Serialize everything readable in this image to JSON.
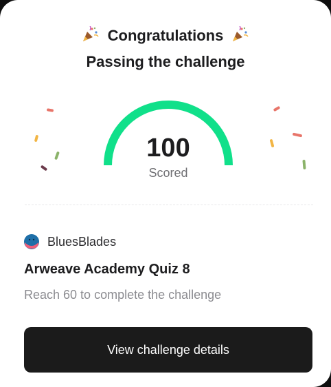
{
  "header": {
    "title": "Congratulations",
    "subtitle": "Passing the challenge",
    "title_icon": "party-popper-icon"
  },
  "result": {
    "score": "100",
    "score_label": "Scored",
    "progress": 1.0,
    "gauge_color": "#10e08a"
  },
  "challenge": {
    "creator": "BluesBlades",
    "avatar_icon": "creator-avatar-icon",
    "quiz_title": "Arweave Academy Quiz 8",
    "requirement": "Reach 60 to complete the challenge"
  },
  "actions": {
    "details_button": "View challenge details"
  },
  "colors": {
    "button_bg": "#1b1b1b",
    "muted_text": "#8b8b90",
    "confetti": [
      "#e8756a",
      "#f2b544",
      "#8bb36a",
      "#6b3a4b"
    ]
  }
}
